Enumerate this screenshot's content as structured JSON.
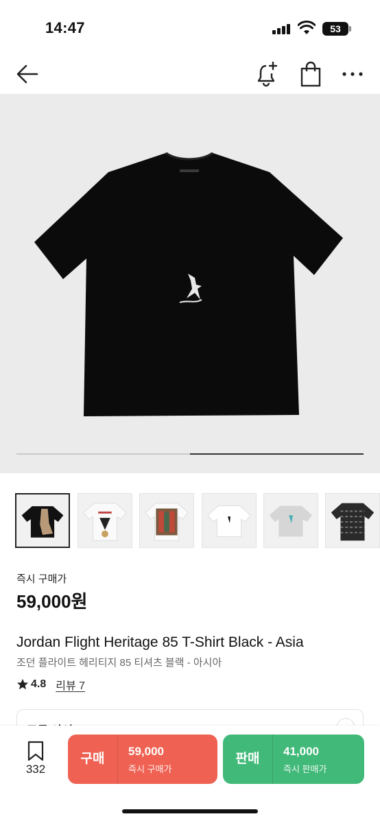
{
  "status_bar": {
    "time": "14:47",
    "battery": "53"
  },
  "hero": {
    "progress_start": 0.5,
    "progress_end": 1.0
  },
  "thumbnails": [
    {
      "name": "thumb-1",
      "active": true
    },
    {
      "name": "thumb-2",
      "active": false
    },
    {
      "name": "thumb-3",
      "active": false
    },
    {
      "name": "thumb-4",
      "active": false
    },
    {
      "name": "thumb-5",
      "active": false
    },
    {
      "name": "thumb-6",
      "active": false
    }
  ],
  "price": {
    "label": "즉시 구매가",
    "value": "59,000원"
  },
  "product": {
    "name_en": "Jordan Flight Heritage 85 T-Shirt Black - Asia",
    "name_ko": "조던 플라이트 헤리티지 85 티셔츠 블랙 - 아시아",
    "rating": "4.8",
    "review_label": "리뷰 7"
  },
  "size": {
    "label": "모든 사이즈"
  },
  "bottom_bar": {
    "wish_count": "332",
    "buy": {
      "title": "구매",
      "price": "59,000",
      "sub": "즉시 구매가"
    },
    "sell": {
      "title": "판매",
      "price": "41,000",
      "sub": "즉시 판매가"
    }
  },
  "colors": {
    "buy": "#ef6253",
    "sell": "#41b979",
    "hero_bg": "#ebebeb"
  }
}
